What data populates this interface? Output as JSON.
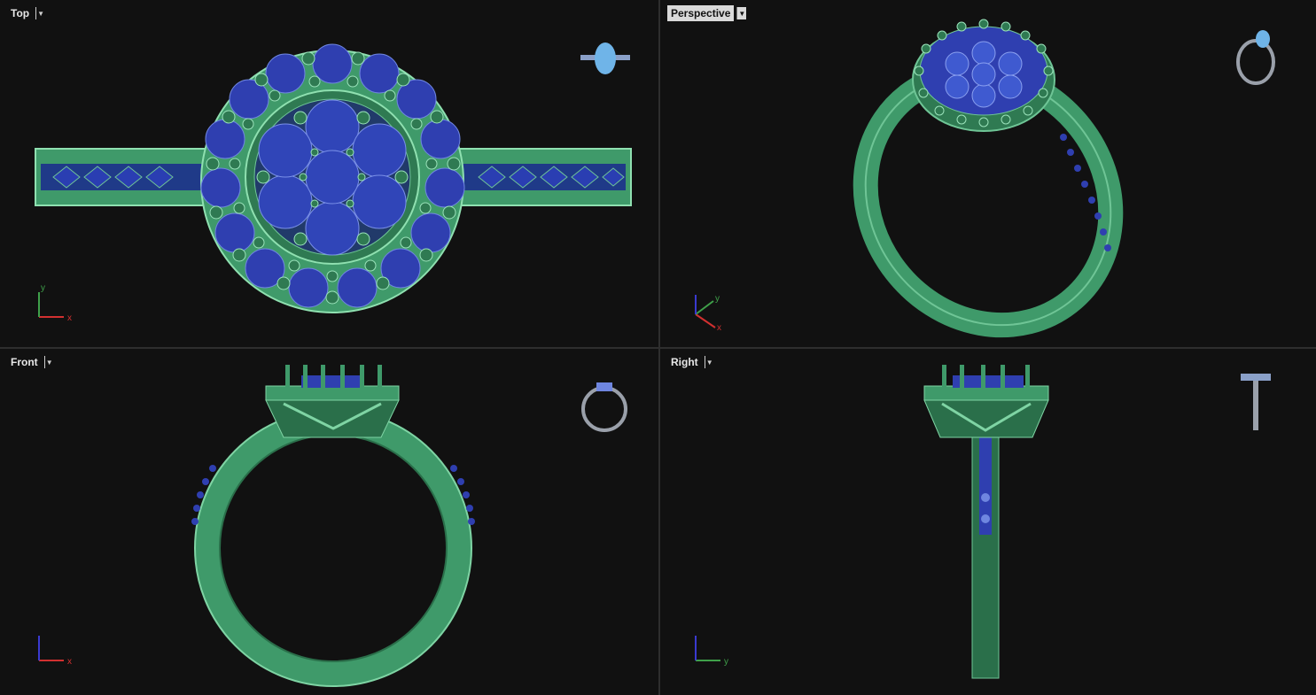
{
  "viewports": {
    "top": {
      "title": "Top",
      "active": false,
      "axes": [
        "x",
        "y"
      ]
    },
    "perspective": {
      "title": "Perspective",
      "active": true,
      "axes": [
        "x",
        "y"
      ]
    },
    "front": {
      "title": "Front",
      "active": false,
      "axes": [
        "x",
        "z"
      ]
    },
    "right": {
      "title": "Right",
      "active": false,
      "axes": [
        "y",
        "z"
      ]
    }
  },
  "colors": {
    "background": "#111111",
    "metal": "#3f9a6a",
    "metal_light": "#6fc596",
    "gem": "#2f3fb0",
    "gem_light": "#6f86e0",
    "axis_x": "#d23030",
    "axis_y": "#3fa04a",
    "axis_z": "#3a3ad0"
  }
}
